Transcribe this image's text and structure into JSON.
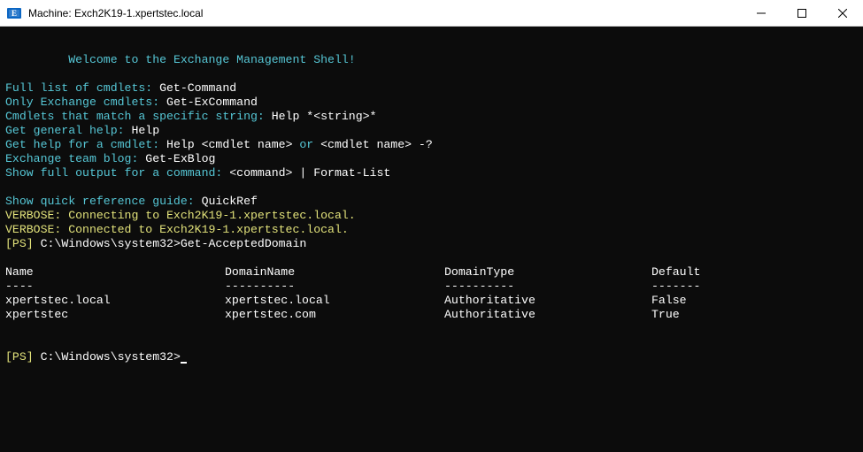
{
  "titlebar": {
    "title": "Machine: Exch2K19-1.xpertstec.local"
  },
  "terminal": {
    "welcome_indent": "         ",
    "welcome": "Welcome to the Exchange Management Shell!",
    "help": {
      "l1a": "Full list of cmdlets: ",
      "l1b": "Get-Command",
      "l2a": "Only Exchange cmdlets: ",
      "l2b": "Get-ExCommand",
      "l3a": "Cmdlets that match a specific string: ",
      "l3b": "Help *<string>*",
      "l4a": "Get general help: ",
      "l4b": "Help",
      "l5a": "Get help for a cmdlet: ",
      "l5b": "Help <cmdlet name>",
      "l5c": " or ",
      "l5d": "<cmdlet name> -?",
      "l6a": "Exchange team blog: ",
      "l6b": "Get-ExBlog",
      "l7a": "Show full output for a command: ",
      "l7b": "<command> | Format-List",
      "l8a": "Show quick reference guide: ",
      "l8b": "QuickRef"
    },
    "verbose1": "VERBOSE: Connecting to Exch2K19-1.xpertstec.local.",
    "verbose2": "VERBOSE: Connected to Exch2K19-1.xpertstec.local.",
    "prompt1_open": "[PS] ",
    "prompt1_path": "C:\\Windows\\system32>",
    "command1": "Get-AcceptedDomain",
    "table": {
      "h_name": "Name",
      "h_dname": "DomainName",
      "h_dtype": "DomainType",
      "h_def": "Default",
      "s_name": "----",
      "s_dname": "----------",
      "s_dtype": "----------",
      "s_def": "-------",
      "r1_name": "xpertstec.local",
      "r1_dname": "xpertstec.local",
      "r1_dtype": "Authoritative",
      "r1_def": "False",
      "r2_name": "xpertstec",
      "r2_dname": "xpertstec.com",
      "r2_dtype": "Authoritative",
      "r2_def": "True"
    },
    "prompt2_open": "[PS] ",
    "prompt2_path": "C:\\Windows\\system32>"
  }
}
